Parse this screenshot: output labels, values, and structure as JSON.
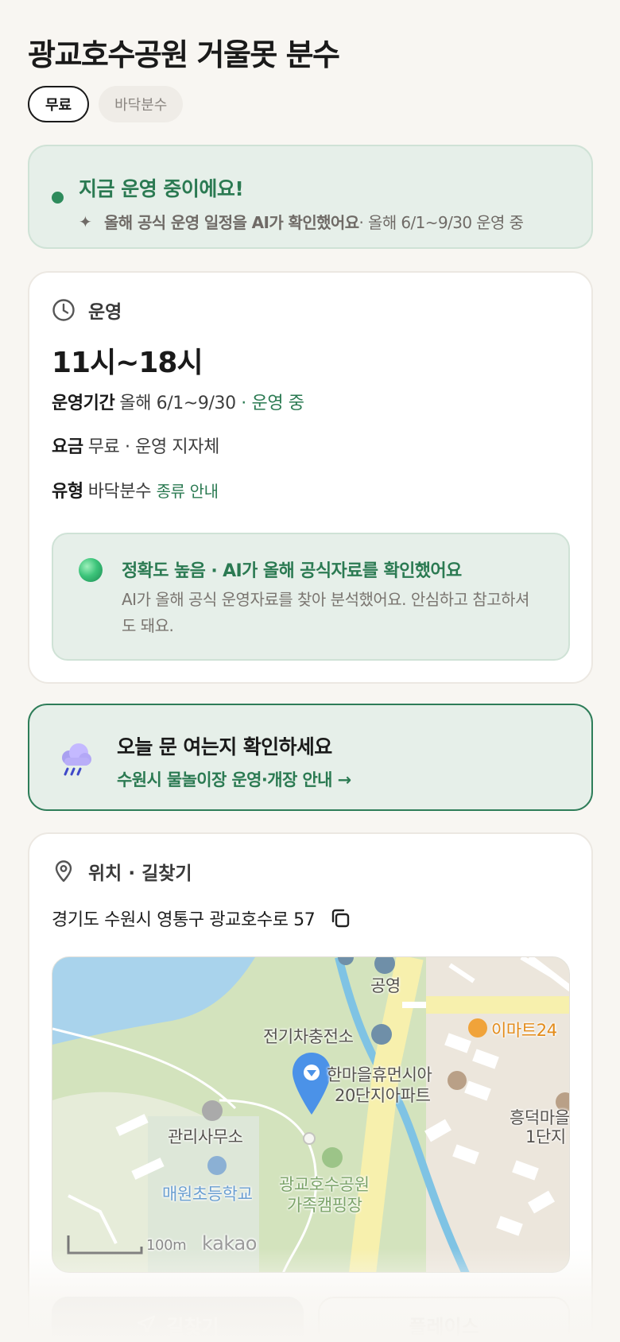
{
  "title": "광교호수공원 거울못 분수",
  "chips": [
    "무료",
    "바닥분수"
  ],
  "status": {
    "title": "지금 운영 중이에요!",
    "sub_bold": "올해 공식 운영 일정을 AI가 확인했어요",
    "sub_rest": " · 올해 6/1~9/30 운영 중",
    "color": "#2b7a52"
  },
  "operation": {
    "header": "운영",
    "hours": "11시~18시",
    "period_key": "운영기간",
    "period_val": "올해 6/1~9/30",
    "period_status": " · 운영 중",
    "fee_key": "요금",
    "fee_val": "무료 · 운영 지자체",
    "type_key": "유형",
    "type_val": "바닥분수",
    "type_link": "종류 안내",
    "accuracy_title": "정확도 높음 · AI가 올해 공식자료를 확인했어요",
    "accuracy_body": "AI가 올해 공식 운영자료를 찾아 분석했어요. 안심하고 참고하셔도 돼요."
  },
  "cta": {
    "title": "오늘 문 여는지 확인하세요",
    "link": "수원시 물놀이장 운영·개장 안내 →"
  },
  "location": {
    "header": "위치 · 길찾기",
    "address": "경기도 수원시 영통구 광교호수로 57",
    "map": {
      "labels": [
        "공영",
        "전기차충전소",
        "이마트24",
        "한마을휴먼시아",
        "20단지아파트",
        "관리사무소",
        "흥덕마을",
        "1단지",
        "매원초등학교",
        "광교호수공원",
        "가족캠핑장"
      ],
      "scale": "100m",
      "brand": "kakao"
    }
  },
  "buttons": {
    "directions": "길찾기",
    "place": "플레이스"
  }
}
